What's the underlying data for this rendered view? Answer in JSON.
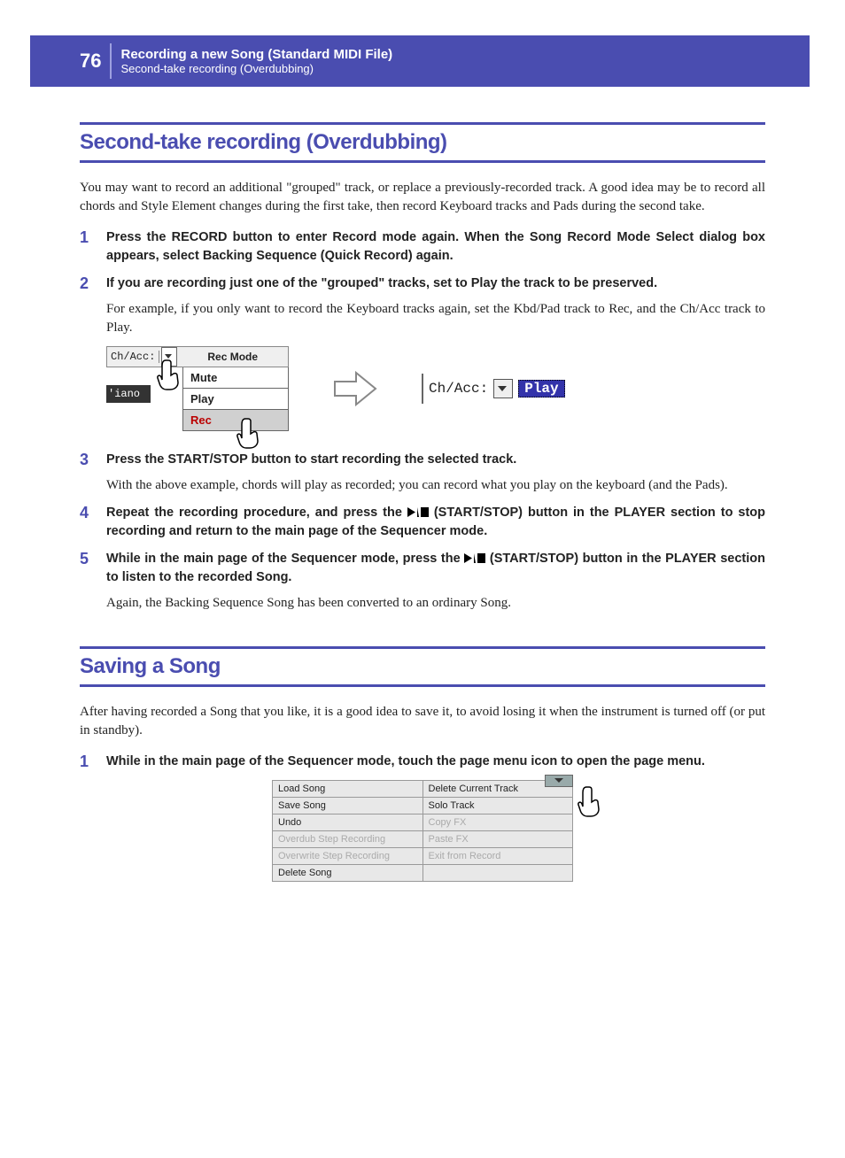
{
  "header": {
    "page_number": "76",
    "chapter": "Recording a new Song (Standard MIDI File)",
    "section": "Second-take recording (Overdubbing)"
  },
  "section1": {
    "title": "Second-take recording (Overdubbing)",
    "intro": "You may want to record an additional \"grouped\" track, or replace a previously-recorded track. A good idea may be to record all chords and Style Element changes during the first take, then record Keyboard tracks and Pads during the second take.",
    "steps": {
      "s1": {
        "num": "1",
        "bold": "Press the RECORD button to enter Record mode again. When the Song Record Mode Select dialog box appears, select Backing Sequence (Quick Record) again."
      },
      "s2": {
        "num": "2",
        "bold": "If you are recording just one of the \"grouped\" tracks, set to Play the track to be preserved.",
        "plain": "For example, if you only want to record the Keyboard tracks again, set the Kbd/Pad track to Rec, and the Ch/Acc track to Play."
      },
      "s3": {
        "num": "3",
        "bold": "Press the START/STOP button to start recording the selected track.",
        "plain": "With the above example, chords will play as recorded; you can record what you play on the keyboard (and the Pads)."
      },
      "s4": {
        "num": "4",
        "bold_a": "Repeat the recording procedure, and press the ",
        "bold_b": " (START/STOP) button in the PLAYER section to stop recording and return to the main page of the Sequencer mode."
      },
      "s5": {
        "num": "5",
        "bold_a": "While in the main page of the Sequencer mode, press the ",
        "bold_b": " (START/STOP) button in the PLAYER section to listen to the recorded Song.",
        "plain": "Again, the Backing Sequence Song has been converted to an ordinary Song."
      }
    },
    "fig1": {
      "chacc_label": "Ch/Acc:",
      "rec_mode": "Rec Mode",
      "mute": "Mute",
      "play": "Play",
      "rec": "Rec",
      "piano": "'iano",
      "result_label": "Ch/Acc:",
      "result_value": "Play"
    }
  },
  "section2": {
    "title": "Saving a Song",
    "intro": "After having recorded a Song that you like, it is a good idea to save it, to avoid losing it when the instrument is turned off (or put in standby).",
    "steps": {
      "s1": {
        "num": "1",
        "bold": "While in the main page of the Sequencer mode, touch the page menu icon to open the page menu."
      }
    },
    "menu": {
      "r1c1": "Load Song",
      "r1c2": "Delete Current Track",
      "r2c1": "Save Song",
      "r2c2": "Solo Track",
      "r3c1": "Undo",
      "r3c2": "Copy FX",
      "r4c1": "Overdub Step Recording",
      "r4c2": "Paste FX",
      "r5c1": "Overwrite Step Recording",
      "r5c2": "Exit from Record",
      "r6c1": "Delete Song",
      "r6c2": ""
    }
  }
}
